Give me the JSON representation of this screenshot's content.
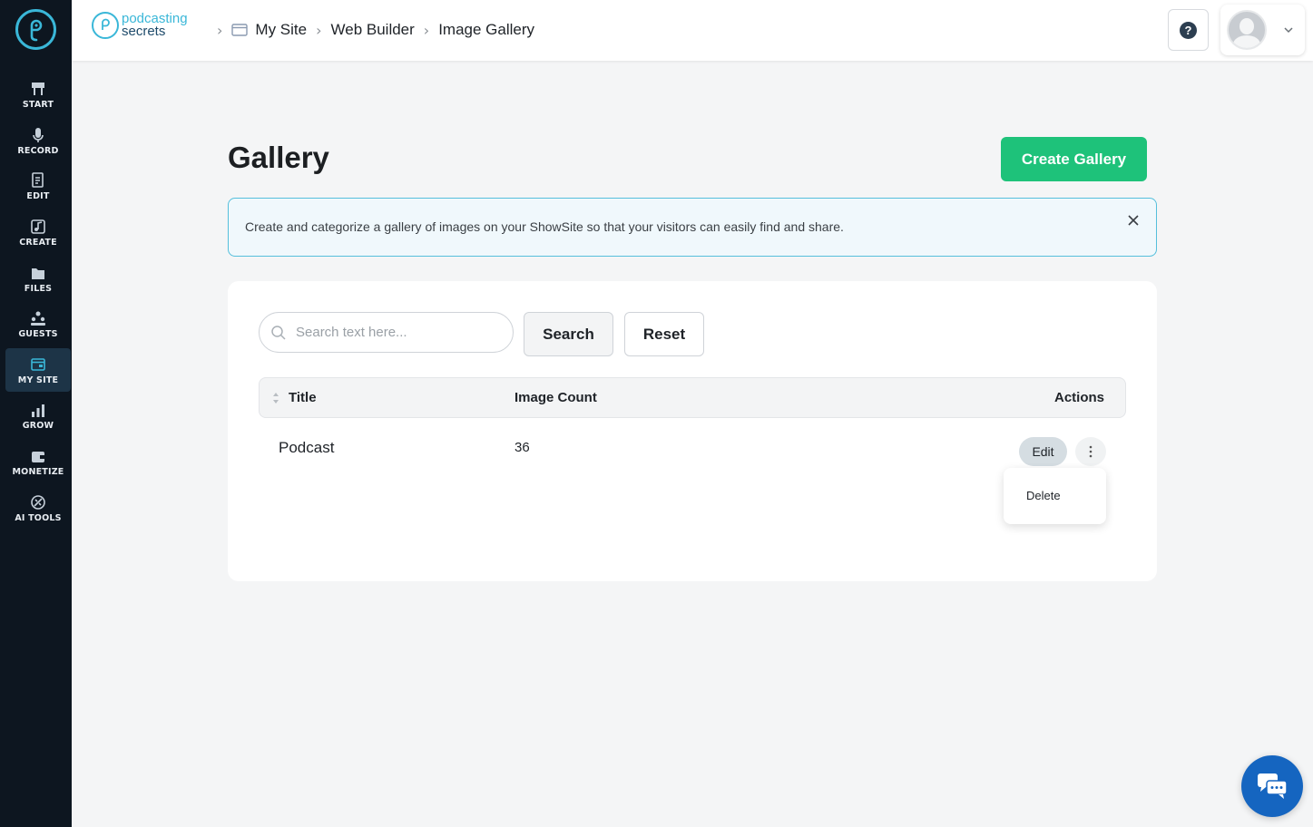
{
  "sidebar": {
    "items": [
      {
        "label": "START",
        "icon": "start-sign-icon"
      },
      {
        "label": "RECORD",
        "icon": "microphone-icon"
      },
      {
        "label": "EDIT",
        "icon": "edit-file-icon"
      },
      {
        "label": "CREATE",
        "icon": "create-music-icon"
      },
      {
        "label": "FILES",
        "icon": "folder-icon"
      },
      {
        "label": "GUESTS",
        "icon": "guests-icon"
      },
      {
        "label": "MY SITE",
        "icon": "website-icon"
      },
      {
        "label": "GROW",
        "icon": "bar-chart-icon"
      },
      {
        "label": "MONETIZE",
        "icon": "wallet-icon"
      },
      {
        "label": "AI TOOLS",
        "icon": "ai-tools-icon"
      }
    ],
    "active": "MY SITE"
  },
  "header": {
    "brand_line1": "podcasting",
    "brand_line2": "secrets",
    "breadcrumbs": [
      "My Site",
      "Web Builder",
      "Image Gallery"
    ],
    "help_label": "?"
  },
  "main": {
    "title": "Gallery",
    "create_button": "Create Gallery",
    "info_text": "Create and categorize a gallery of images on your ShowSite so that your visitors can easily find and share.",
    "search": {
      "placeholder": "Search text here...",
      "value": ""
    },
    "search_button": "Search",
    "reset_button": "Reset",
    "table": {
      "columns": [
        "Title",
        "Image Count",
        "Actions"
      ],
      "rows": [
        {
          "title": "Podcast",
          "image_count": "36",
          "edit_label": "Edit"
        }
      ]
    },
    "dropdown_items": [
      "Delete"
    ]
  },
  "colors": {
    "sidebar_bg": "#0d1620",
    "accent_green": "#1ec27a",
    "brand_blue": "#3ab7d8",
    "chat_blue": "#1565c0"
  }
}
